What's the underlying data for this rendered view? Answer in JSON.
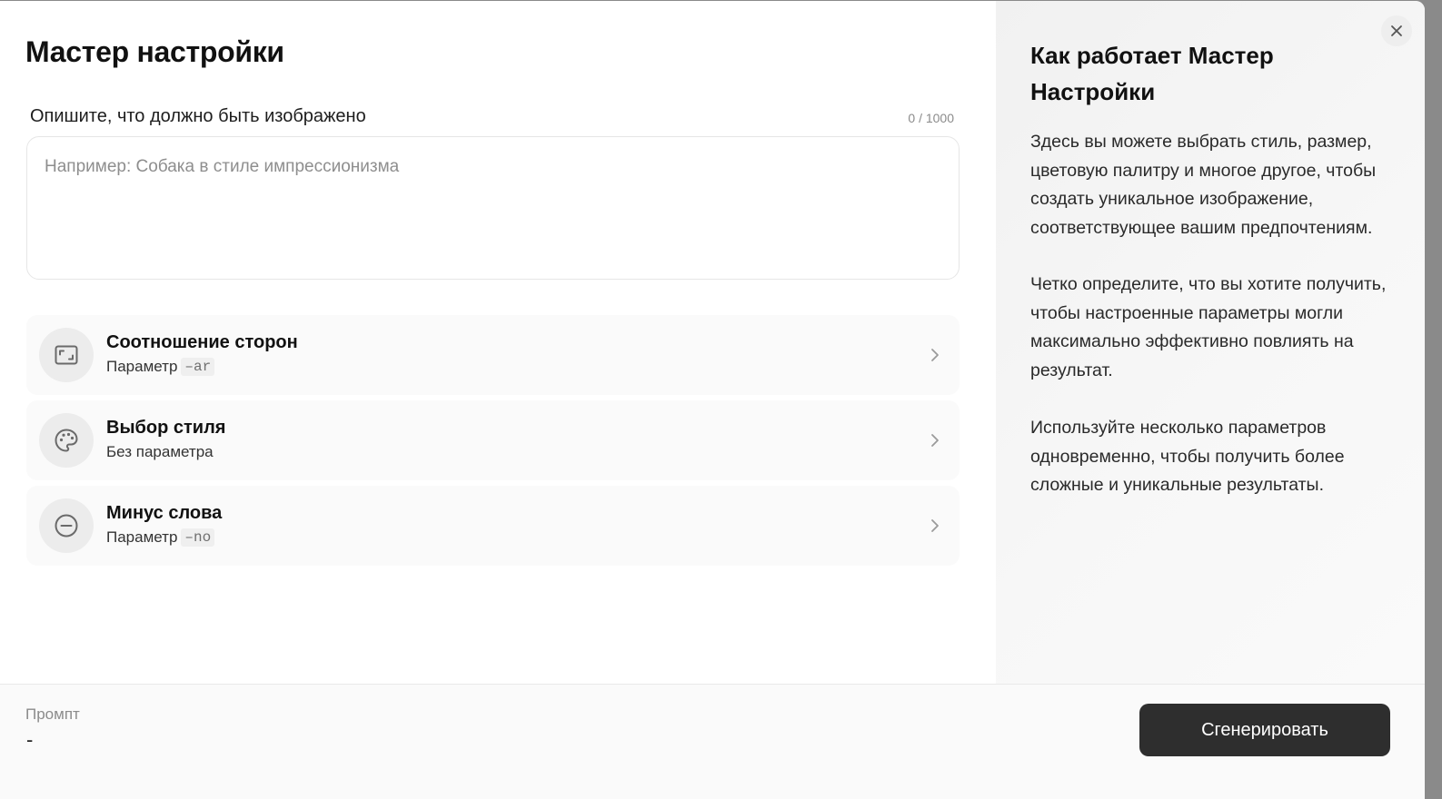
{
  "dialog": {
    "title": "Мастер настройки",
    "close_icon": "close-icon"
  },
  "prompt_field": {
    "label": "Опишите, что должно быть изображено",
    "counter": "0 / 1000",
    "value": "",
    "placeholder": "Например: Собака в стиле импрессионизма"
  },
  "options": [
    {
      "title": "Соотношение сторон",
      "sub_prefix": "Параметр",
      "code": "–ar",
      "icon": "aspect-ratio-icon"
    },
    {
      "title": "Выбор стиля",
      "sub_prefix": "Без параметра",
      "code": "",
      "icon": "palette-icon"
    },
    {
      "title": "Минус слова",
      "sub_prefix": "Параметр",
      "code": "–no",
      "icon": "minus-circle-icon"
    }
  ],
  "help": {
    "title": "Как работает Мастер Настройки",
    "paragraphs": [
      "Здесь вы можете выбрать стиль, размер, цветовую палитру и многое другое, чтобы создать уникальное изображение, соответствующее вашим предпочтениям.",
      "Четко определите, что вы хотите получить, чтобы настроенные параметры могли максимально эффективно повлиять на результат.",
      "Используйте несколько параметров одновременно, чтобы получить более сложные и уникальные результаты."
    ]
  },
  "footer": {
    "prompt_label": "Промпт",
    "prompt_value": "-",
    "generate_label": "Сгенерировать"
  },
  "colors": {
    "primary_button": "#2e2e2e",
    "icon_bg": "#ececec",
    "card_bg": "#fafafa"
  }
}
